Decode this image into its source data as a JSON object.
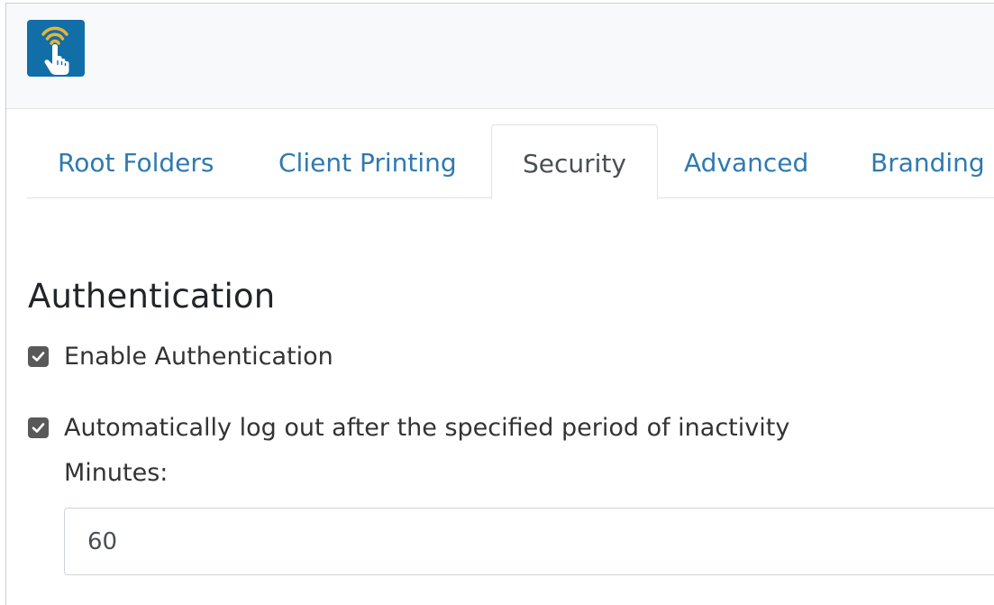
{
  "header": {
    "logo_icon": "tap-signal-hand-icon"
  },
  "tabs": [
    {
      "label": "Root Folders",
      "active": false
    },
    {
      "label": "Client Printing",
      "active": false
    },
    {
      "label": "Security",
      "active": true
    },
    {
      "label": "Advanced",
      "active": false
    },
    {
      "label": "Branding",
      "active": false
    }
  ],
  "authentication": {
    "title": "Authentication",
    "enable_auth": {
      "label": "Enable Authentication",
      "checked": true
    },
    "auto_logout": {
      "label": "Automatically log out after the specified period of inactivity",
      "checked": true
    },
    "minutes": {
      "label": "Minutes:",
      "value": "60"
    }
  },
  "colors": {
    "accent": "#126ea6",
    "tab_link": "#2f7ab0",
    "checkbox": "#595959",
    "logo_signal": "#e8b43a"
  }
}
